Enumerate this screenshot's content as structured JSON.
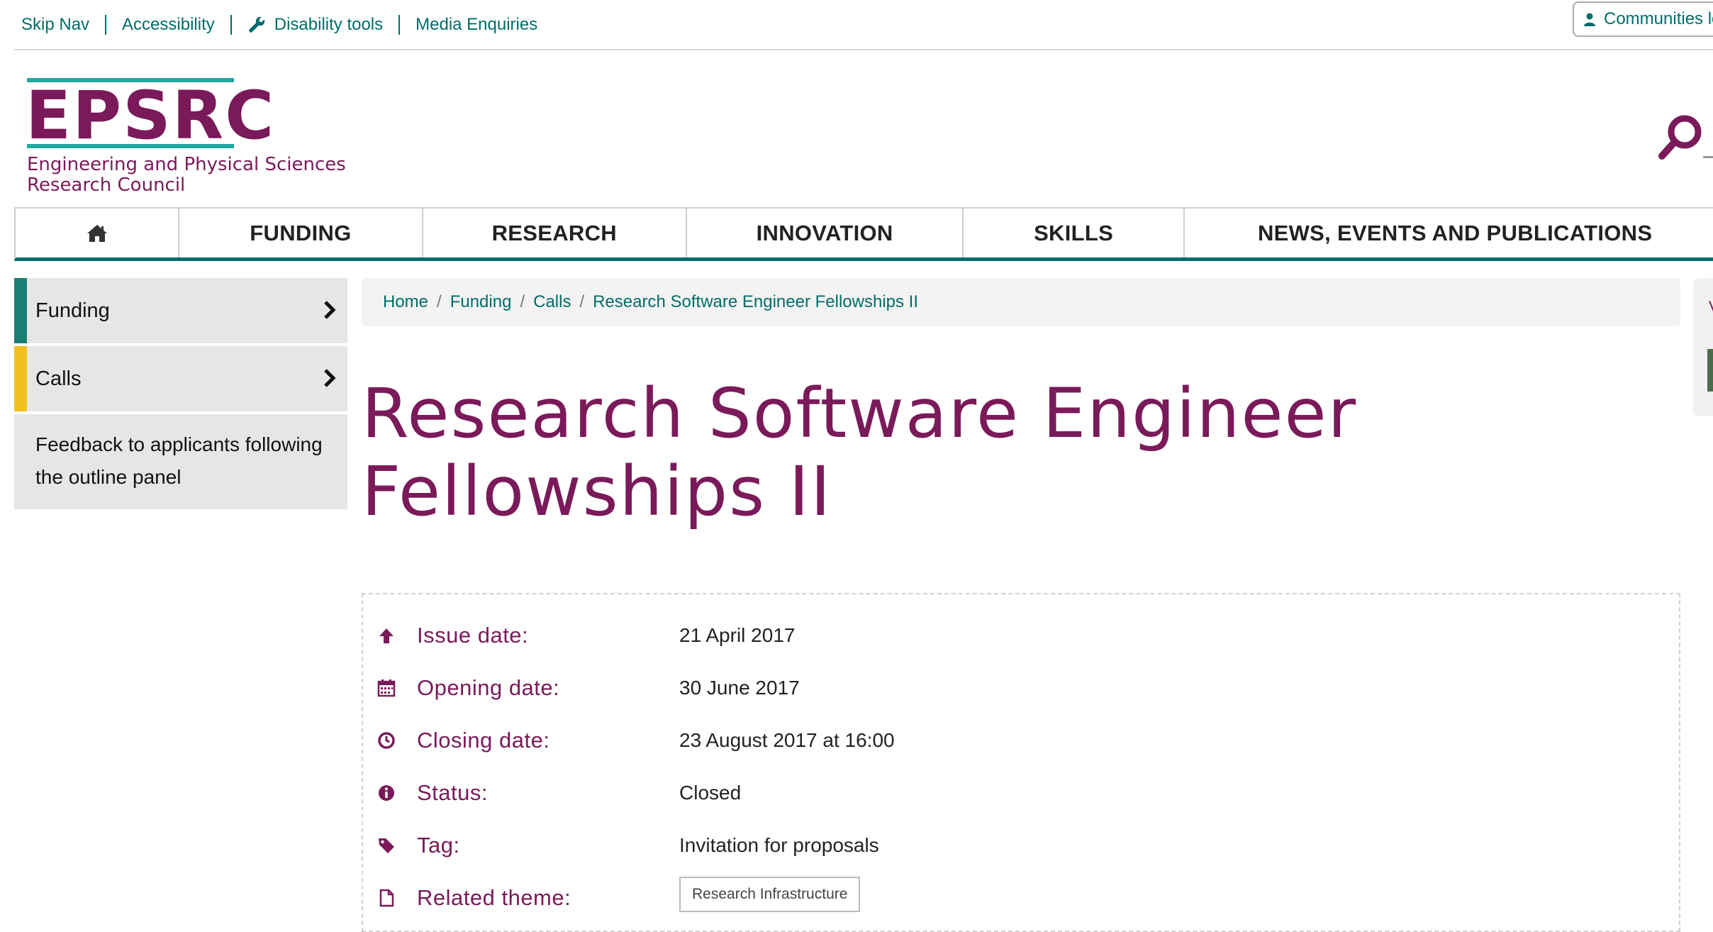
{
  "topbar": {
    "links": [
      "Skip Nav",
      "Accessibility",
      "Disability tools",
      "Media Enquiries"
    ],
    "communities_label": "Communities lo"
  },
  "logo": {
    "acronym": "EPSRC",
    "line1": "Engineering and Physical Sciences",
    "line2": "Research Council"
  },
  "nav": {
    "items": [
      "FUNDING",
      "RESEARCH",
      "INNOVATION",
      "SKILLS",
      "NEWS, EVENTS AND PUBLICATIONS"
    ]
  },
  "sidebar": {
    "items": [
      {
        "label": "Funding",
        "accent": "#1a7e72"
      },
      {
        "label": "Calls",
        "accent": "#f2c01e"
      },
      {
        "label": "Feedback to applicants following the outline panel"
      }
    ]
  },
  "breadcrumb": [
    "Home",
    "Funding",
    "Calls",
    "Research Software Engineer Fellowships II"
  ],
  "page": {
    "title": "Research Software Engineer Fellowships II"
  },
  "details": [
    {
      "icon": "arrow-up-icon",
      "label": "Issue date:",
      "value": "21 April 2017"
    },
    {
      "icon": "calendar-icon",
      "label": "Opening date:",
      "value": "30 June 2017"
    },
    {
      "icon": "clock-icon",
      "label": "Closing date:",
      "value": "23 August 2017 at 16:00"
    },
    {
      "icon": "info-icon",
      "label": "Status:",
      "value": "Closed"
    },
    {
      "icon": "tag-icon",
      "label": "Tag:",
      "value": "Invitation for proposals"
    },
    {
      "icon": "document-icon",
      "label": "Related theme:",
      "value": "Research Infrastructure"
    }
  ],
  "colors": {
    "brand": "#7a1a5a",
    "link": "#006d6a",
    "logo_bar": "#1fa89f"
  }
}
